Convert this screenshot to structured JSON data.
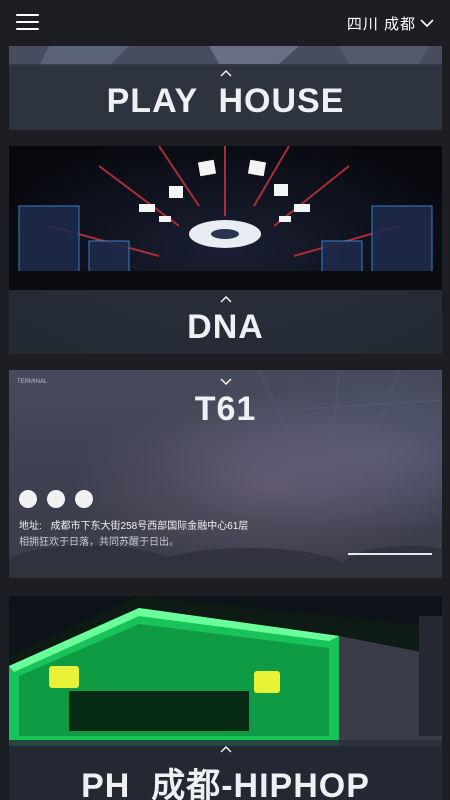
{
  "header": {
    "location": "四川 成都"
  },
  "venues": [
    {
      "title": "PLAY  HOUSE"
    },
    {
      "title": "DNA"
    },
    {
      "title": "T61",
      "address_label": "地址:",
      "address": "成都市下东大街258号西部国际金融中心61层",
      "slogan": "相拥狂欢于日落，共同苏醒于日出。",
      "image_sign": "TERMINAL"
    },
    {
      "title": "PH  成都-HIPHOP"
    }
  ],
  "colors": {
    "page_bg": "#1d1e23",
    "overlay": "#2d3440",
    "text": "#eef0f4"
  }
}
